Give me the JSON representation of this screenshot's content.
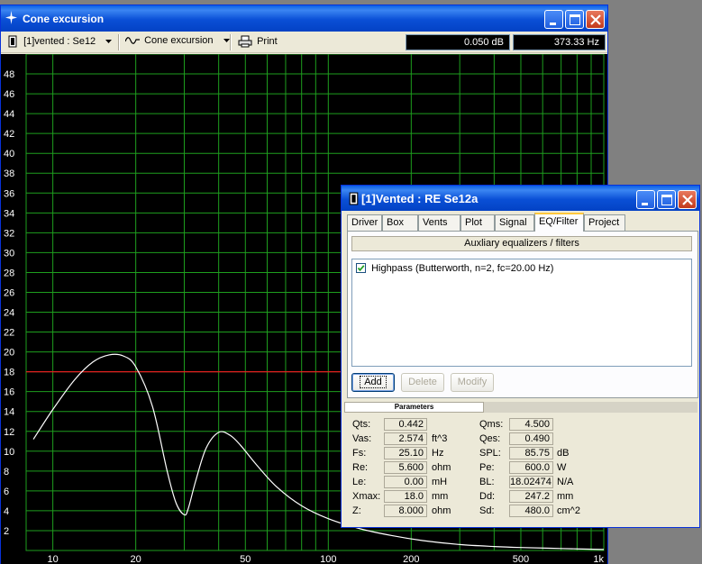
{
  "main_window": {
    "title": "Cone excursion",
    "toolbar": {
      "driver_select": "[1]vented : Se12",
      "graph_select": "Cone excursion",
      "print_label": "Print",
      "readout_db": "0.050 dB",
      "readout_hz": "373.33 Hz"
    }
  },
  "chart_data": {
    "type": "line",
    "title": "",
    "xlabel": "",
    "ylabel": "",
    "x_scale": "log",
    "xlim": [
      8,
      1000
    ],
    "ylim": [
      0,
      50
    ],
    "grid": true,
    "x_tick_labels": [
      "10",
      "20",
      "50",
      "100",
      "200",
      "500",
      "1k"
    ],
    "x_ticks": [
      10,
      20,
      50,
      100,
      200,
      500,
      1000
    ],
    "y_ticks": [
      2,
      4,
      6,
      8,
      10,
      12,
      14,
      16,
      18,
      20,
      22,
      24,
      26,
      28,
      30,
      32,
      34,
      36,
      38,
      40,
      42,
      44,
      46,
      48
    ],
    "y_tick_labels": [
      "2",
      "4",
      "6",
      "8",
      "10",
      "12",
      "14",
      "16",
      "18",
      "20",
      "22",
      "24",
      "26",
      "28",
      "30",
      "32",
      "34",
      "36",
      "38",
      "40",
      "42",
      "44",
      "46",
      "48"
    ],
    "reference_line": {
      "y": 18,
      "color": "#E02020"
    },
    "series": [
      {
        "color": "#FFFFFF",
        "x": [
          8.5,
          10,
          12,
          14,
          16,
          18,
          20,
          23,
          26,
          28,
          30,
          31,
          33,
          36,
          40,
          44,
          48,
          55,
          65,
          80,
          100,
          130,
          170,
          220,
          300,
          400,
          500,
          700,
          1000
        ],
        "y": [
          11.2,
          14.2,
          17.2,
          19.0,
          19.7,
          19.6,
          18.5,
          14.5,
          8.0,
          4.8,
          3.6,
          4.2,
          7.0,
          10.3,
          11.9,
          11.6,
          10.6,
          8.6,
          6.4,
          4.5,
          3.2,
          2.2,
          1.5,
          1.0,
          0.6,
          0.4,
          0.3,
          0.2,
          0.1
        ]
      }
    ]
  },
  "dialog": {
    "title": "[1]Vented : RE Se12a",
    "tabs": [
      "Driver",
      "Box",
      "Vents",
      "Plot",
      "Signal",
      "EQ/Filter",
      "Project"
    ],
    "active_tab": "EQ/Filter",
    "group_label": "Auxliary equalizers / filters",
    "filters": [
      {
        "label": "Highpass (Butterworth, n=2, fc=20.00 Hz)",
        "checked": true
      }
    ],
    "buttons": {
      "add": "Add",
      "delete": "Delete",
      "modify": "Modify"
    },
    "params_title": "Parameters",
    "params_left": [
      {
        "label": "Qts:",
        "value": "0.442",
        "unit": ""
      },
      {
        "label": "Vas:",
        "value": "2.574",
        "unit": "ft^3"
      },
      {
        "label": "Fs:",
        "value": "25.10",
        "unit": "Hz"
      },
      {
        "label": "Re:",
        "value": "5.600",
        "unit": "ohm"
      },
      {
        "label": "Le:",
        "value": "0.00",
        "unit": "mH"
      },
      {
        "label": "Xmax:",
        "value": "18.0",
        "unit": "mm"
      },
      {
        "label": "Z:",
        "value": "8.000",
        "unit": "ohm"
      }
    ],
    "params_right": [
      {
        "label": "Qms:",
        "value": "4.500",
        "unit": ""
      },
      {
        "label": "Qes:",
        "value": "0.490",
        "unit": ""
      },
      {
        "label": "SPL:",
        "value": "85.75",
        "unit": "dB"
      },
      {
        "label": "Pe:",
        "value": "600.0",
        "unit": "W"
      },
      {
        "label": "BL:",
        "value": "18.02474",
        "unit": "N/A"
      },
      {
        "label": "Dd:",
        "value": "247.2",
        "unit": "mm"
      },
      {
        "label": "Sd:",
        "value": "480.0",
        "unit": "cm^2"
      }
    ]
  }
}
